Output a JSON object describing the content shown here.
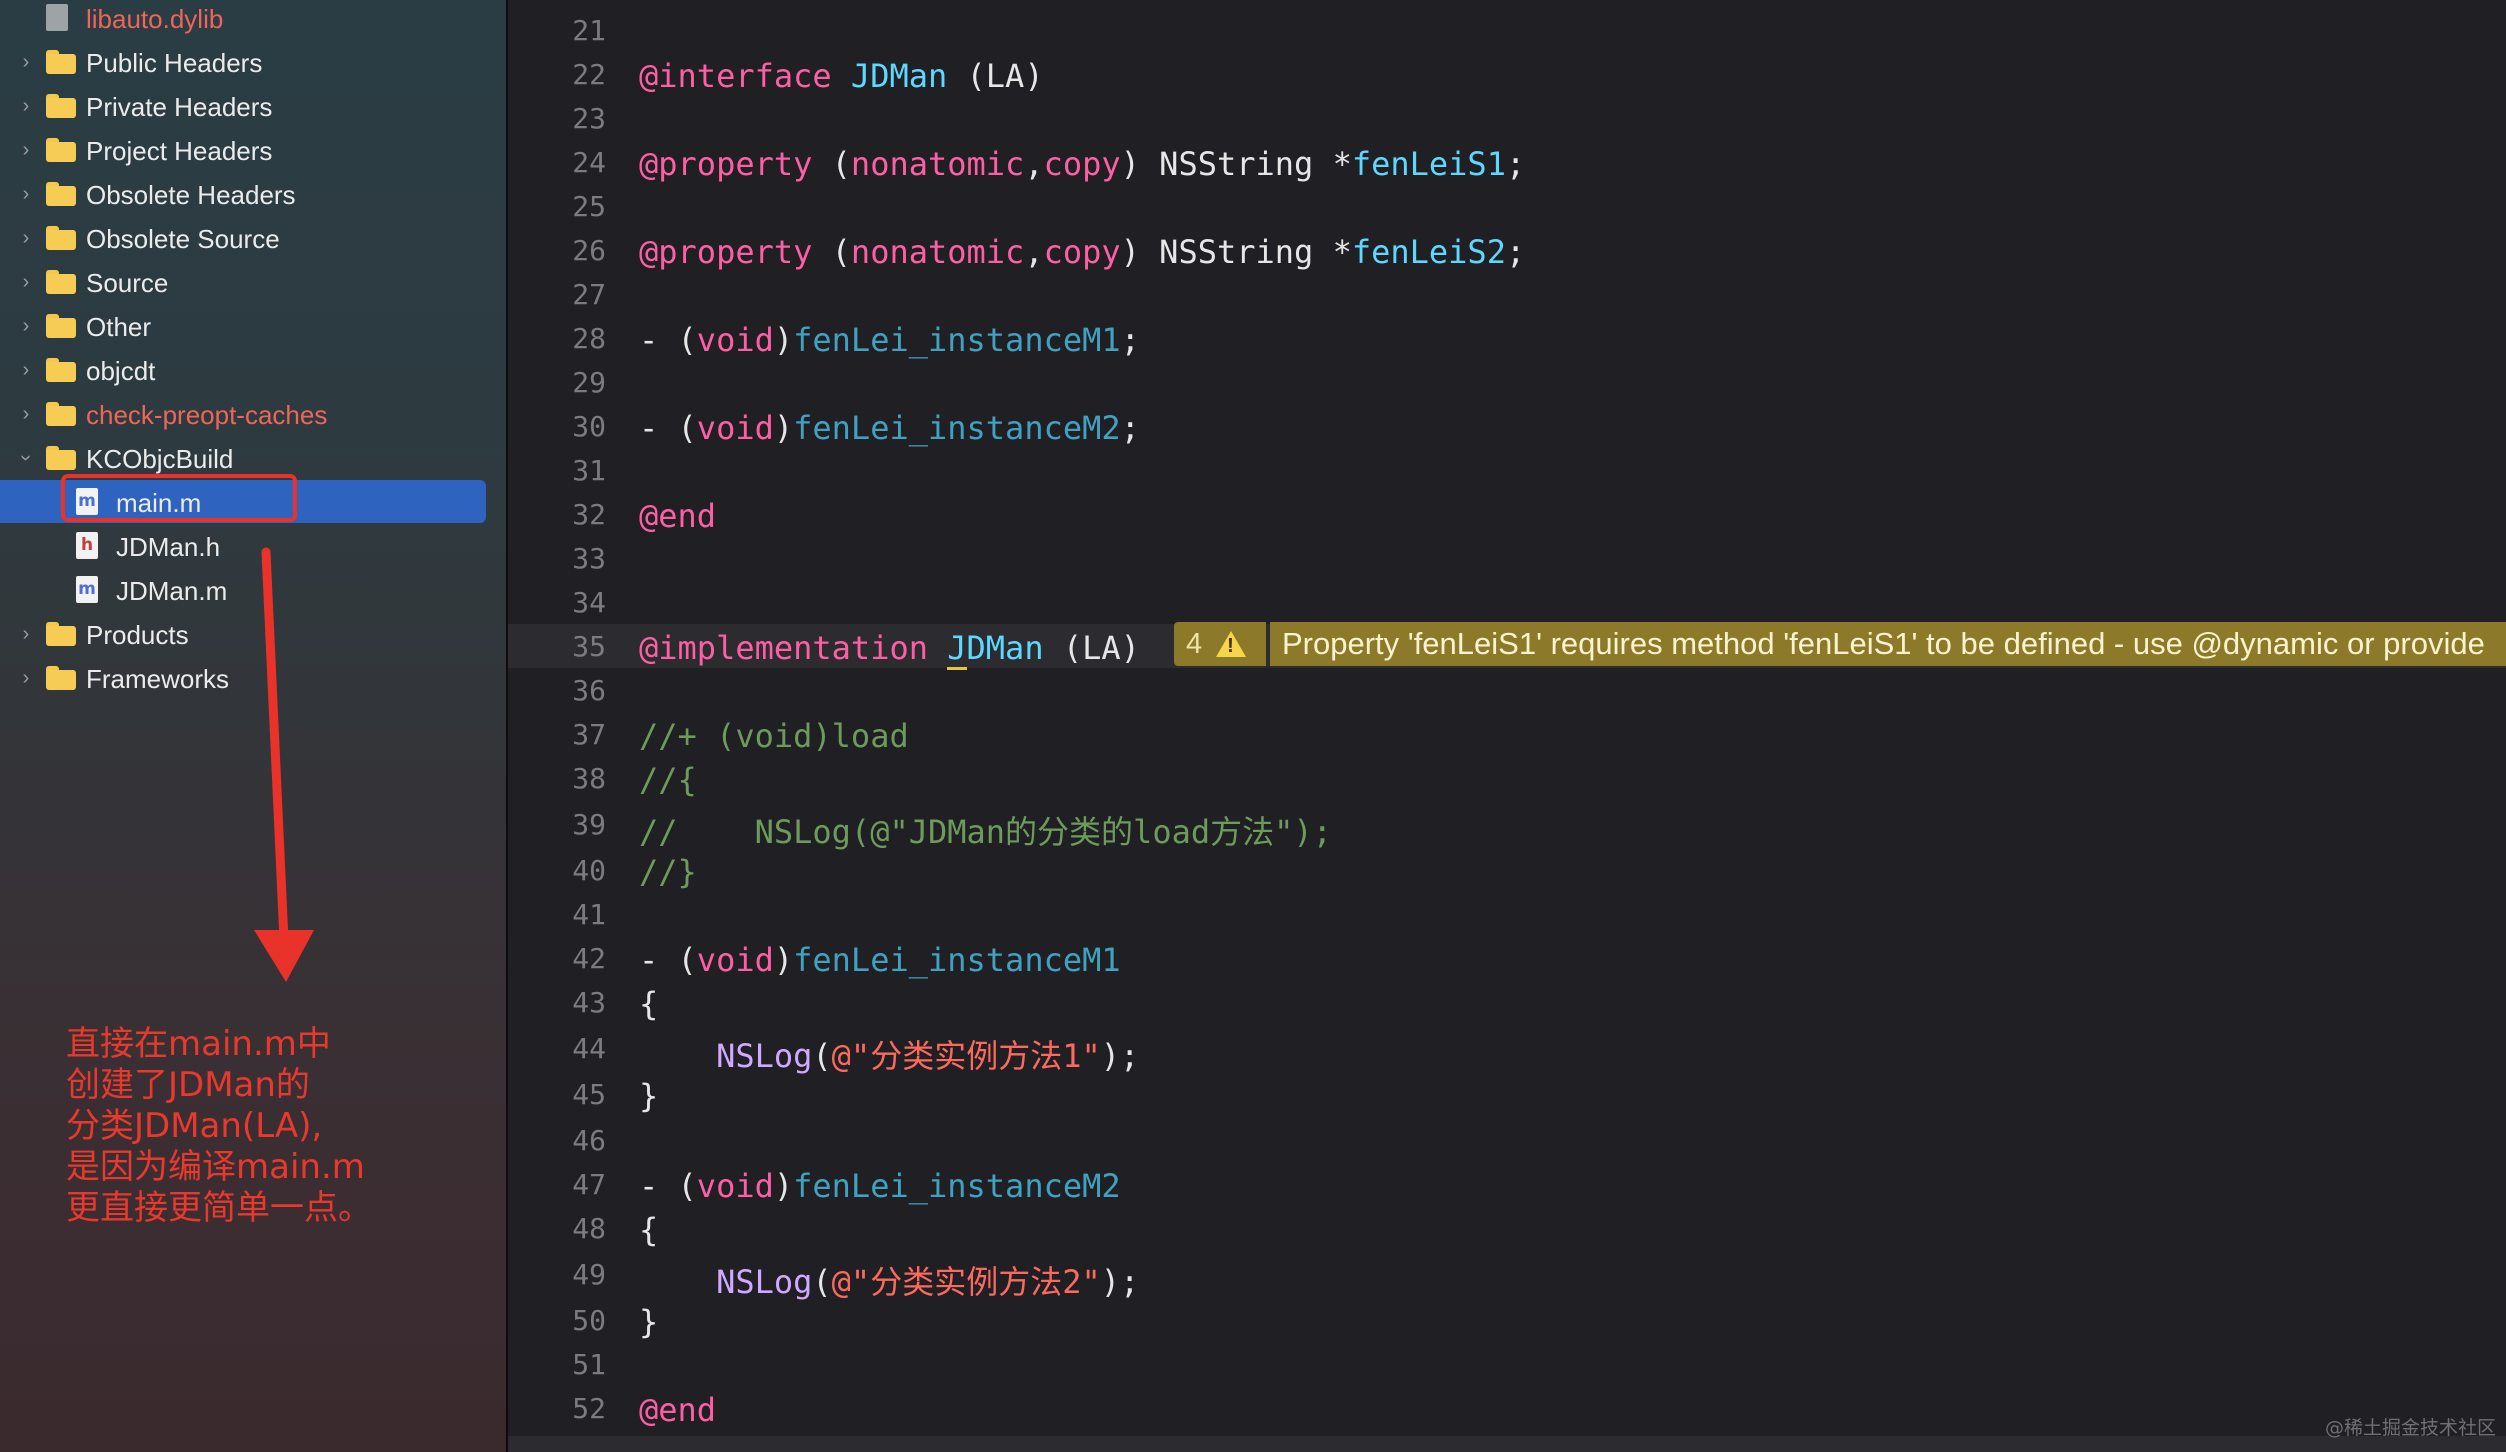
{
  "navigator": {
    "items": [
      {
        "label": "libauto.dylib",
        "kind": "file-dylib",
        "expandable": false,
        "red": true
      },
      {
        "label": "Public Headers",
        "kind": "folder",
        "expandable": true,
        "red": false
      },
      {
        "label": "Private Headers",
        "kind": "folder",
        "expandable": true,
        "red": false
      },
      {
        "label": "Project Headers",
        "kind": "folder",
        "expandable": true,
        "red": false
      },
      {
        "label": "Obsolete Headers",
        "kind": "folder",
        "expandable": true,
        "red": false
      },
      {
        "label": "Obsolete Source",
        "kind": "folder",
        "expandable": true,
        "red": false
      },
      {
        "label": "Source",
        "kind": "folder",
        "expandable": true,
        "red": false
      },
      {
        "label": "Other",
        "kind": "folder",
        "expandable": true,
        "red": false
      },
      {
        "label": "objcdt",
        "kind": "folder",
        "expandable": true,
        "red": false
      },
      {
        "label": "check-preopt-caches",
        "kind": "folder",
        "expandable": true,
        "red": true
      },
      {
        "label": "KCObjcBuild",
        "kind": "folder",
        "expandable": true,
        "expanded": true,
        "red": false
      },
      {
        "label": "main.m",
        "kind": "file-m",
        "selected": true,
        "red": false
      },
      {
        "label": "JDMan.h",
        "kind": "file-h",
        "red": false
      },
      {
        "label": "JDMan.m",
        "kind": "file-m",
        "red": false
      },
      {
        "label": "Products",
        "kind": "folder",
        "expandable": true,
        "red": false
      },
      {
        "label": "Frameworks",
        "kind": "folder",
        "expandable": true,
        "red": false
      }
    ]
  },
  "annotation": {
    "lines": [
      "直接在main.m中",
      "创建了JDMan的",
      "分类JDMan(LA),",
      "是因为编译main.m",
      "更直接更简单一点。"
    ],
    "color": "#e8392c"
  },
  "editor": {
    "lines": [
      {
        "n": "21",
        "tokens": []
      },
      {
        "n": "22",
        "tokens": [
          [
            "kw",
            "@interface"
          ],
          [
            "plain",
            " "
          ],
          [
            "type-decl",
            "JDMan"
          ],
          [
            "plain",
            " (LA)"
          ]
        ]
      },
      {
        "n": "23",
        "tokens": []
      },
      {
        "n": "24",
        "tokens": [
          [
            "kw",
            "@property"
          ],
          [
            "plain",
            " ("
          ],
          [
            "kw",
            "nonatomic"
          ],
          [
            "plain",
            ","
          ],
          [
            "kw",
            "copy"
          ],
          [
            "plain",
            ") NSString *"
          ],
          [
            "type-decl",
            "fenLeiS1"
          ],
          [
            "plain",
            ";"
          ]
        ]
      },
      {
        "n": "25",
        "tokens": []
      },
      {
        "n": "26",
        "tokens": [
          [
            "kw",
            "@property"
          ],
          [
            "plain",
            " ("
          ],
          [
            "kw",
            "nonatomic"
          ],
          [
            "plain",
            ","
          ],
          [
            "kw",
            "copy"
          ],
          [
            "plain",
            ") NSString *"
          ],
          [
            "type-decl",
            "fenLeiS2"
          ],
          [
            "plain",
            ";"
          ]
        ]
      },
      {
        "n": "27",
        "tokens": []
      },
      {
        "n": "28",
        "tokens": [
          [
            "plain",
            "- ("
          ],
          [
            "kw",
            "void"
          ],
          [
            "plain",
            ")"
          ],
          [
            "prop",
            "fenLei_instanceM1"
          ],
          [
            "plain",
            ";"
          ]
        ]
      },
      {
        "n": "29",
        "tokens": []
      },
      {
        "n": "30",
        "tokens": [
          [
            "plain",
            "- ("
          ],
          [
            "kw",
            "void"
          ],
          [
            "plain",
            ")"
          ],
          [
            "prop",
            "fenLei_instanceM2"
          ],
          [
            "plain",
            ";"
          ]
        ]
      },
      {
        "n": "31",
        "tokens": []
      },
      {
        "n": "32",
        "tokens": [
          [
            "kw",
            "@end"
          ]
        ]
      },
      {
        "n": "33",
        "tokens": []
      },
      {
        "n": "34",
        "tokens": []
      },
      {
        "n": "35",
        "current": true,
        "tokens": [
          [
            "kw",
            "@implementation"
          ],
          [
            "plain",
            " "
          ],
          [
            "type-decl warn-underline",
            "J"
          ],
          [
            "type-decl",
            "DMan"
          ],
          [
            "plain",
            " (LA)"
          ]
        ]
      },
      {
        "n": "36",
        "tokens": []
      },
      {
        "n": "37",
        "tokens": [
          [
            "cmt",
            "//+ (void)load"
          ]
        ]
      },
      {
        "n": "38",
        "tokens": [
          [
            "cmt",
            "//{"
          ]
        ]
      },
      {
        "n": "39",
        "tokens": [
          [
            "cmt",
            "//    NSLog(@\"JDMan的分类的load方法\");"
          ]
        ]
      },
      {
        "n": "40",
        "tokens": [
          [
            "cmt",
            "//}"
          ]
        ]
      },
      {
        "n": "41",
        "tokens": []
      },
      {
        "n": "42",
        "tokens": [
          [
            "plain",
            "- ("
          ],
          [
            "kw",
            "void"
          ],
          [
            "plain",
            ")"
          ],
          [
            "prop",
            "fenLei_instanceM1"
          ]
        ]
      },
      {
        "n": "43",
        "tokens": [
          [
            "plain",
            "{"
          ]
        ]
      },
      {
        "n": "44",
        "tokens": [
          [
            "plain",
            "    "
          ],
          [
            "cls",
            "NSLog"
          ],
          [
            "plain",
            "("
          ],
          [
            "str",
            "@\"分类实例方法1\""
          ],
          [
            "plain",
            ");"
          ]
        ]
      },
      {
        "n": "45",
        "tokens": [
          [
            "plain",
            "}"
          ]
        ]
      },
      {
        "n": "46",
        "tokens": []
      },
      {
        "n": "47",
        "tokens": [
          [
            "plain",
            "- ("
          ],
          [
            "kw",
            "void"
          ],
          [
            "plain",
            ")"
          ],
          [
            "prop",
            "fenLei_instanceM2"
          ]
        ]
      },
      {
        "n": "48",
        "tokens": [
          [
            "plain",
            "{"
          ]
        ]
      },
      {
        "n": "49",
        "tokens": [
          [
            "plain",
            "    "
          ],
          [
            "cls",
            "NSLog"
          ],
          [
            "plain",
            "("
          ],
          [
            "str",
            "@\"分类实例方法2\""
          ],
          [
            "plain",
            ");"
          ]
        ]
      },
      {
        "n": "50",
        "tokens": [
          [
            "plain",
            "}"
          ]
        ]
      },
      {
        "n": "51",
        "tokens": []
      },
      {
        "n": "52",
        "tokens": [
          [
            "kw",
            "@end"
          ]
        ]
      }
    ],
    "warning": {
      "count": "4",
      "icon": "warning-triangle-icon",
      "message": "Property 'fenLeiS1' requires method 'fenLeiS1' to be defined - use @dynamic or provide"
    }
  },
  "watermark": "@稀土掘金技术社区",
  "colors": {
    "selection": "#2f63c0",
    "annotation_red": "#e8322a",
    "warning_bg": "#8c7a2a",
    "editor_bg": "#1f1f24"
  }
}
